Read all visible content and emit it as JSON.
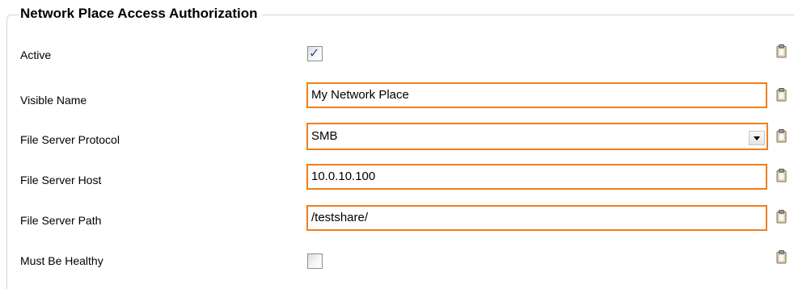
{
  "section": {
    "title": "Network Place Access Authorization"
  },
  "fields": {
    "active": {
      "label": "Active",
      "checked": true
    },
    "visible_name": {
      "label": "Visible Name",
      "value": "My Network Place"
    },
    "protocol": {
      "label": "File Server Protocol",
      "value": "SMB"
    },
    "host": {
      "label": "File Server Host",
      "value": "10.0.10.100"
    },
    "path": {
      "label": "File Server Path",
      "value": "/testshare/"
    },
    "healthy": {
      "label": "Must Be Healthy",
      "checked": false
    }
  },
  "icons": {
    "checkmark": "✓",
    "clipboard": "clipboard-icon"
  },
  "colors": {
    "accent_border": "#f07f1d",
    "check": "#244e9e"
  }
}
